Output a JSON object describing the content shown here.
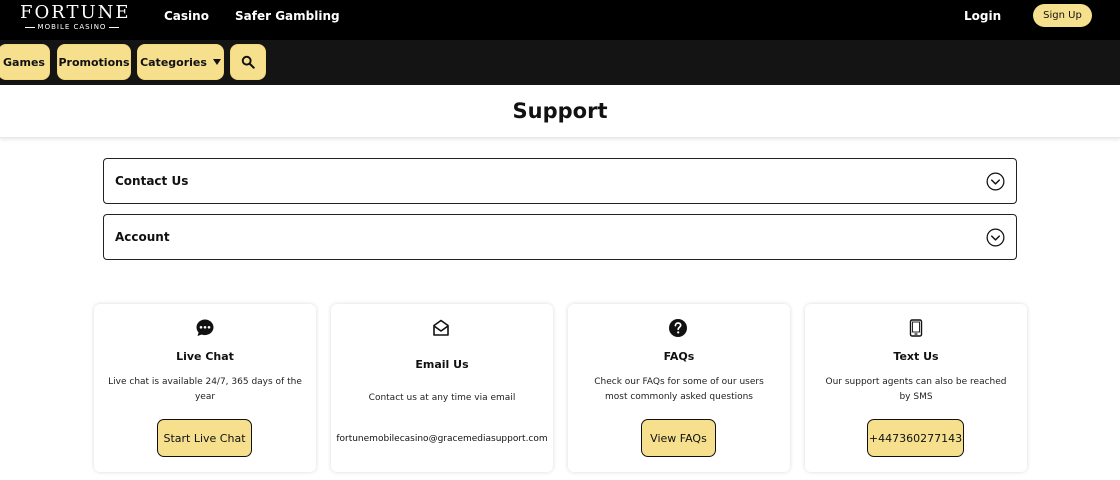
{
  "header": {
    "logo_main": "FORTUNE",
    "logo_sub": "MOBILE CASINO",
    "nav": [
      "Casino",
      "Safer Gambling"
    ],
    "login_label": "Login",
    "signup_label": "Sign Up"
  },
  "subnav": {
    "games_label": "Games",
    "promotions_label": "Promotions",
    "categories_label": "Categories"
  },
  "page": {
    "title": "Support"
  },
  "accordions": [
    {
      "label": "Contact Us"
    },
    {
      "label": "Account"
    }
  ],
  "cards": [
    {
      "icon": "chat-bubble-icon",
      "title": "Live Chat",
      "desc": "Live chat is available 24/7, 365 days of the year",
      "button": "Start Live Chat"
    },
    {
      "icon": "envelope-icon",
      "title": "Email Us",
      "desc": "Contact us at any time via email",
      "email": "fortunemobilecasino@gracemediasupport.com"
    },
    {
      "icon": "question-circle-icon",
      "title": "FAQs",
      "desc": "Check our FAQs for some of our users most commonly asked questions",
      "button": "View FAQs"
    },
    {
      "icon": "mobile-phone-icon",
      "title": "Text Us",
      "desc": "Our support agents can also be reached by SMS",
      "button": "+447360277143"
    }
  ],
  "colors": {
    "accent": "#f6e08e",
    "topbar": "#000000",
    "subbar": "#141414"
  }
}
